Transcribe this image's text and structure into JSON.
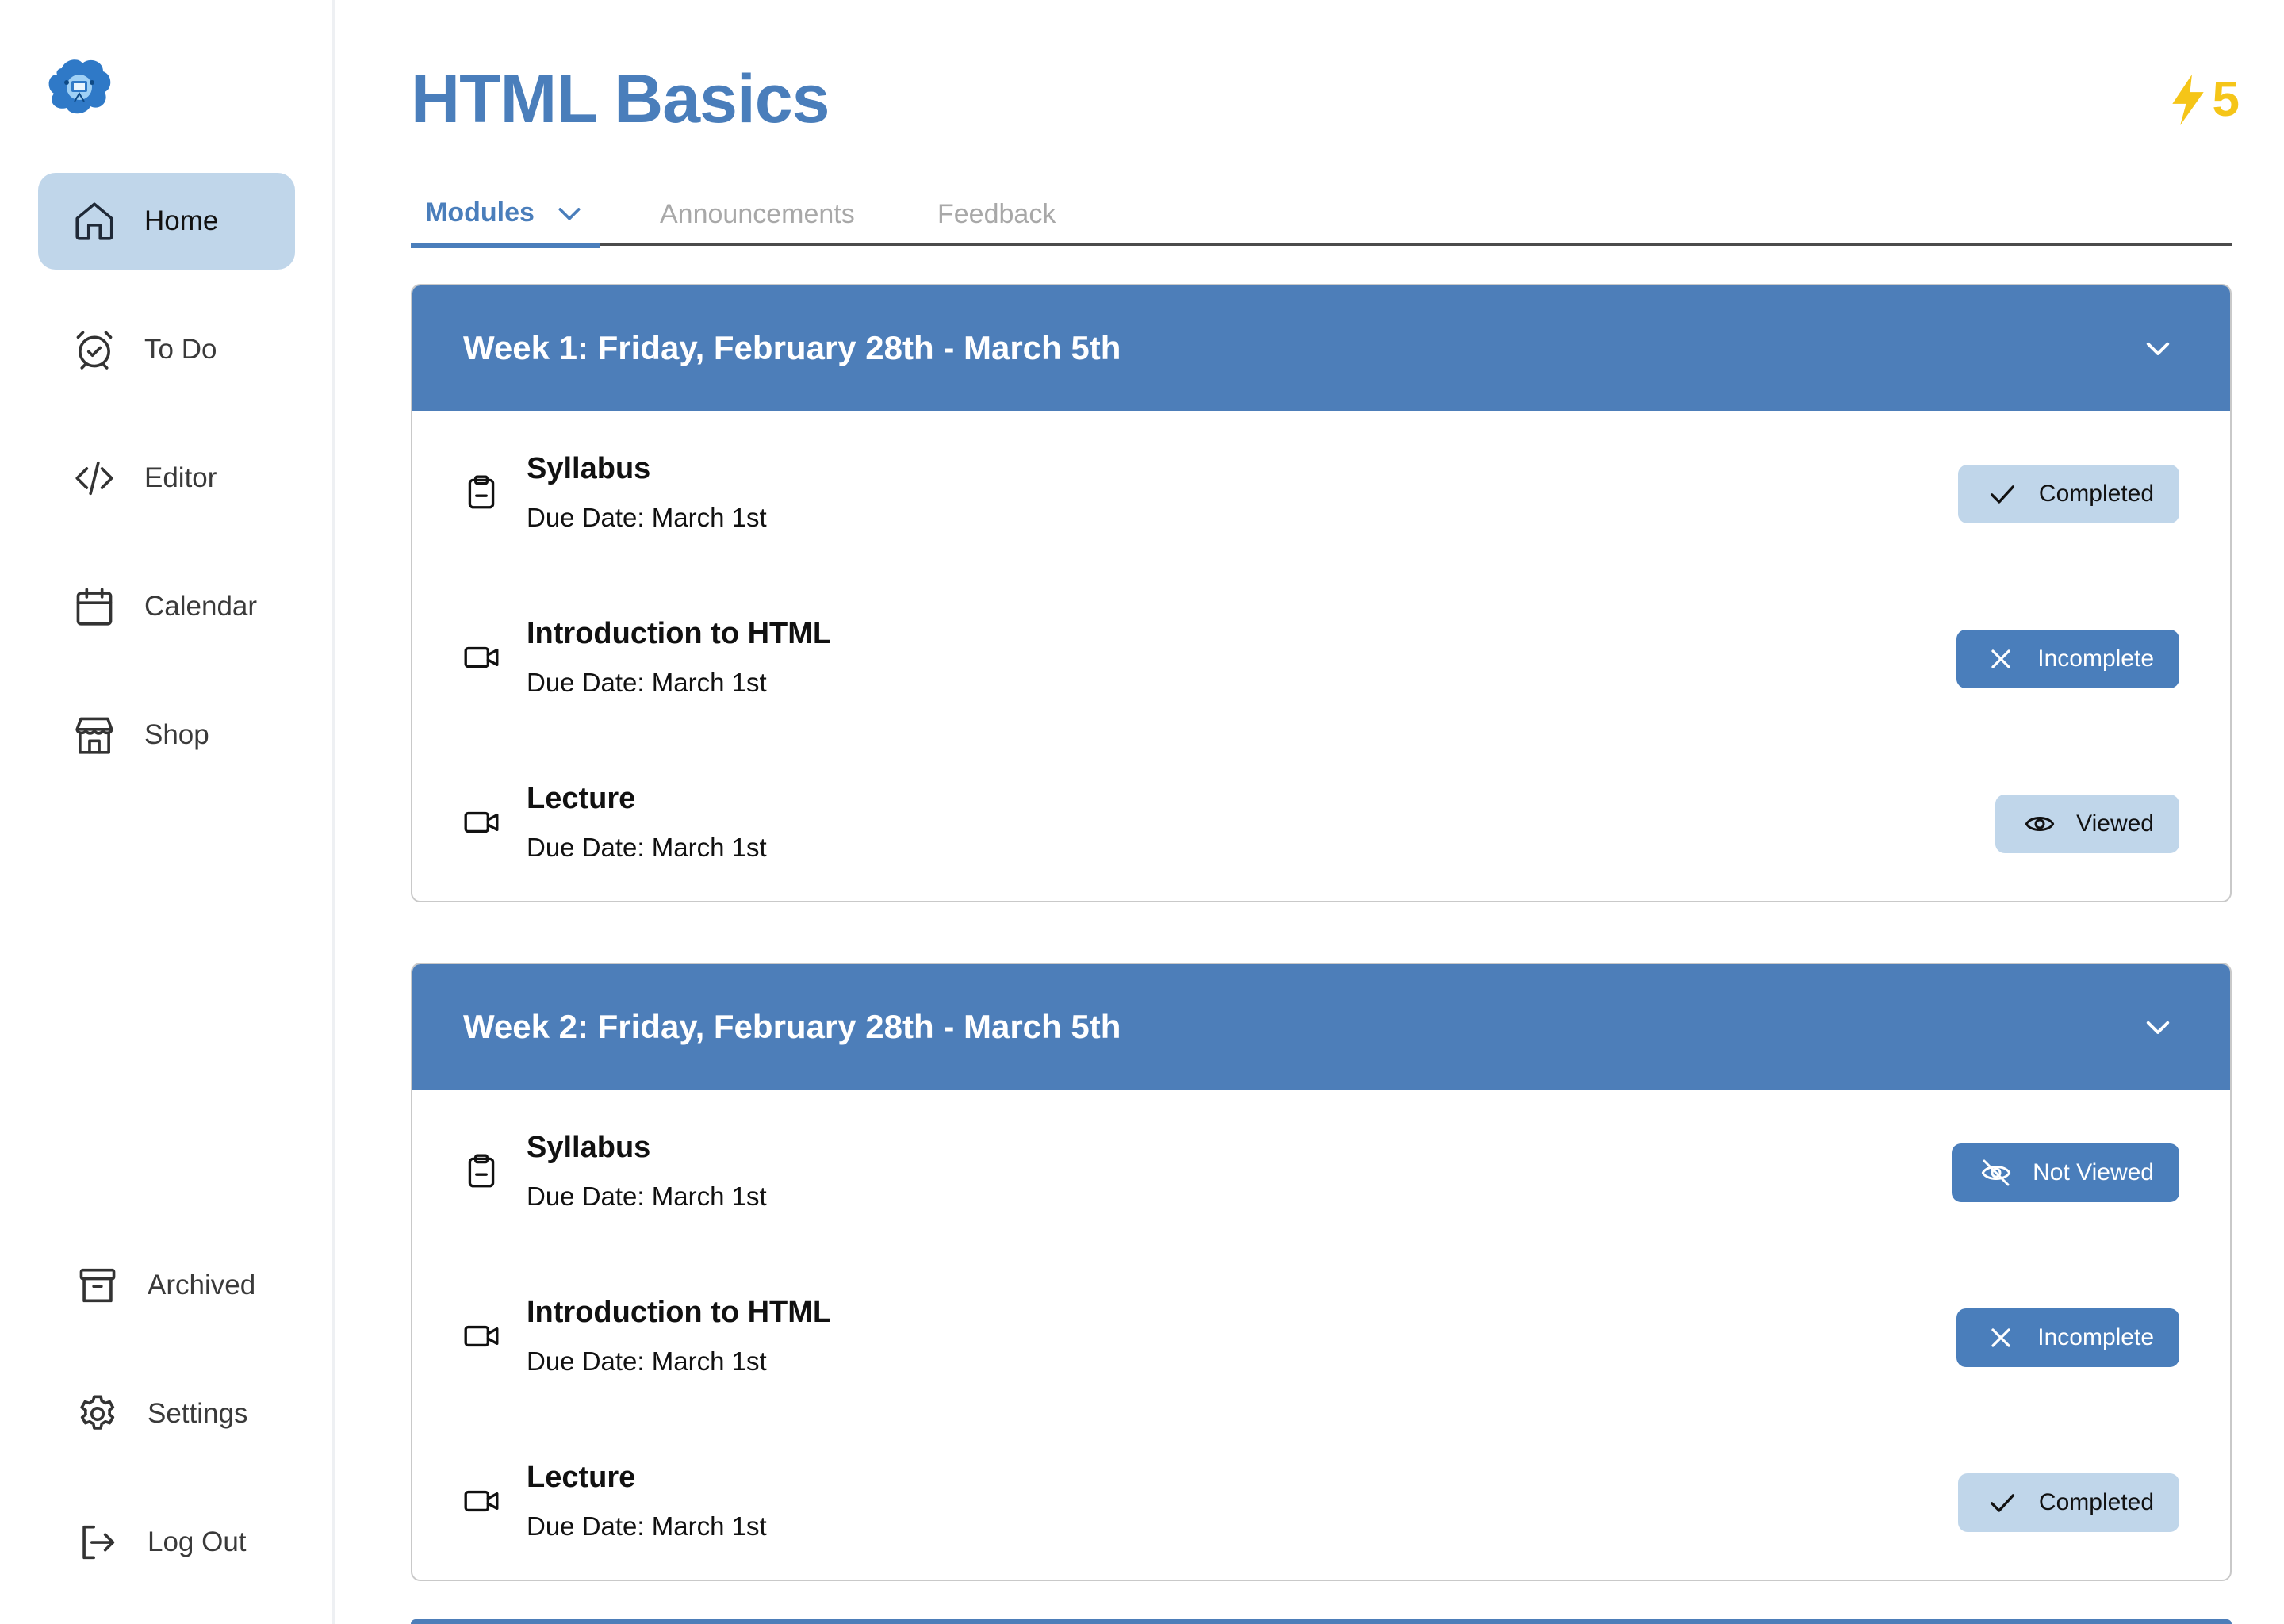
{
  "sidebar": {
    "logo_icon": "brain-mascot-logo",
    "top_items": [
      {
        "label": "Home",
        "icon": "home-icon",
        "active": true
      },
      {
        "label": "To Do",
        "icon": "alarm-clock-icon",
        "active": false
      },
      {
        "label": "Editor",
        "icon": "code-icon",
        "active": false
      },
      {
        "label": "Calendar",
        "icon": "calendar-icon",
        "active": false
      },
      {
        "label": "Shop",
        "icon": "store-icon",
        "active": false
      }
    ],
    "bottom_items": [
      {
        "label": "Archived",
        "icon": "archive-icon"
      },
      {
        "label": "Settings",
        "icon": "gear-icon"
      },
      {
        "label": "Log Out",
        "icon": "logout-icon"
      }
    ]
  },
  "header": {
    "title": "HTML Basics",
    "points": "5",
    "points_icon": "lightning-icon"
  },
  "tabs": [
    {
      "label": "Modules",
      "active": true
    },
    {
      "label": "Announcements",
      "active": false
    },
    {
      "label": "Feedback",
      "active": false
    }
  ],
  "weeks": [
    {
      "title": "Week 1: Friday, February 28th - March 5th",
      "items": [
        {
          "name": "Syllabus",
          "due": "Due Date: March 1st",
          "type_icon": "clipboard-icon",
          "status": "Completed",
          "status_icon": "check-icon",
          "status_style": "light"
        },
        {
          "name": "Introduction to HTML",
          "due": "Due Date: March 1st",
          "type_icon": "video-icon",
          "status": "Incomplete",
          "status_icon": "x-icon",
          "status_style": "dark"
        },
        {
          "name": "Lecture",
          "due": "Due Date: March 1st",
          "type_icon": "video-icon",
          "status": "Viewed",
          "status_icon": "eye-icon",
          "status_style": "light"
        }
      ]
    },
    {
      "title": "Week 2: Friday, February 28th - March 5th",
      "items": [
        {
          "name": "Syllabus",
          "due": "Due Date: March 1st",
          "type_icon": "clipboard-icon",
          "status": "Not Viewed",
          "status_icon": "eye-off-icon",
          "status_style": "dark"
        },
        {
          "name": "Introduction to HTML",
          "due": "Due Date: March 1st",
          "type_icon": "video-icon",
          "status": "Incomplete",
          "status_icon": "x-icon",
          "status_style": "dark"
        },
        {
          "name": "Lecture",
          "due": "Due Date: March 1st",
          "type_icon": "video-icon",
          "status": "Completed",
          "status_icon": "check-icon",
          "status_style": "light"
        }
      ]
    }
  ],
  "colors": {
    "primary": "#4a7ebb",
    "header_bar": "#4d7eb9",
    "light_badge": "#c0d6ea",
    "points": "#f5c518"
  }
}
